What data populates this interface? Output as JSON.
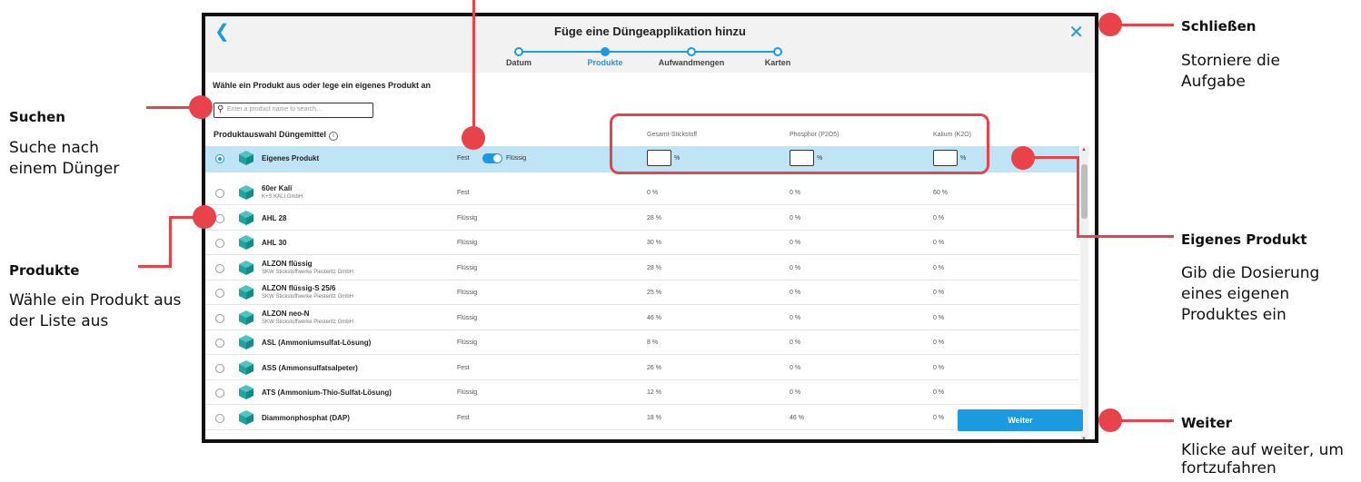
{
  "colors": {
    "accent": "#1a9ae0",
    "annotation": "#e8434b",
    "selected_row": "#bfe4f5",
    "product_icon": "#1fa3a0"
  },
  "dialog": {
    "title": "Füge eine Düngeapplikation hinzu",
    "back_icon": "chevron-left-icon",
    "close_icon": "close-icon",
    "steps": [
      {
        "label": "Datum",
        "active": false
      },
      {
        "label": "Produkte",
        "active": true
      },
      {
        "label": "Aufwandmengen",
        "active": false
      },
      {
        "label": "Karten",
        "active": false
      }
    ],
    "section_heading": "Wähle ein Produkt aus oder lege ein eigenes Produkt an",
    "search": {
      "placeholder": "Enter a product name to search...",
      "value": ""
    },
    "list_heading": "Produktauswahl Düngemittel",
    "columns": [
      "Gesamt-Stickstoff",
      "Phosphor (P2O5)",
      "Kalium (K2O)"
    ],
    "own_product": {
      "name": "Eigenes Produkt",
      "toggle_left": "Fest",
      "toggle_right": "Flüssig",
      "toggle_on": true,
      "unit": "%",
      "values": [
        "",
        "",
        ""
      ]
    },
    "products": [
      {
        "name": "60er Kali",
        "maker": "K+S KALI GmbH",
        "type": "Fest",
        "n": "0 %",
        "p": "0 %",
        "k": "60 %"
      },
      {
        "name": "AHL 28",
        "maker": "",
        "type": "Flüssig",
        "n": "28 %",
        "p": "0 %",
        "k": "0 %"
      },
      {
        "name": "AHL 30",
        "maker": "",
        "type": "Flüssig",
        "n": "30 %",
        "p": "0 %",
        "k": "0 %"
      },
      {
        "name": "ALZON flüssig",
        "maker": "SKW Stickstoffwerke Piesteritz GmbH",
        "type": "Flüssig",
        "n": "28 %",
        "p": "0 %",
        "k": "0 %"
      },
      {
        "name": "ALZON flüssig-S 25/6",
        "maker": "SKW Stickstoffwerke Piesteritz GmbH",
        "type": "Flüssig",
        "n": "25 %",
        "p": "0 %",
        "k": "0 %"
      },
      {
        "name": "ALZON neo-N",
        "maker": "SKW Stickstoffwerke Piesteritz GmbH",
        "type": "Flüssig",
        "n": "46 %",
        "p": "0 %",
        "k": "0 %"
      },
      {
        "name": "ASL (Ammoniumsulfat-Lösung)",
        "maker": "",
        "type": "Flüssig",
        "n": "8 %",
        "p": "0 %",
        "k": "0 %"
      },
      {
        "name": "ASS (Ammonsulfatsalpeter)",
        "maker": "",
        "type": "Fest",
        "n": "26 %",
        "p": "0 %",
        "k": "0 %"
      },
      {
        "name": "ATS (Ammonium-Thio-Sulfat-Lösung)",
        "maker": "",
        "type": "Flüssig",
        "n": "12 %",
        "p": "0 %",
        "k": "0 %"
      },
      {
        "name": "Diammonphosphat (DAP)",
        "maker": "",
        "type": "Fest",
        "n": "18 %",
        "p": "46 %",
        "k": "0 %"
      }
    ],
    "next_button": "Weiter"
  },
  "annotations": {
    "close": {
      "title": "Schließen",
      "desc": "Storniere die Aufgabe"
    },
    "search": {
      "title": "Suchen",
      "desc": "Suche nach einem Dünger"
    },
    "products": {
      "title": "Produkte",
      "desc": "Wähle ein Produkt aus der Liste aus"
    },
    "own_product": {
      "title": "Eigenes Produkt",
      "desc": "Gib die Dosierung eines eigenen Produktes ein"
    },
    "next": {
      "title": "Weiter",
      "desc": "Klicke auf weiter, um fortzufahren"
    }
  }
}
